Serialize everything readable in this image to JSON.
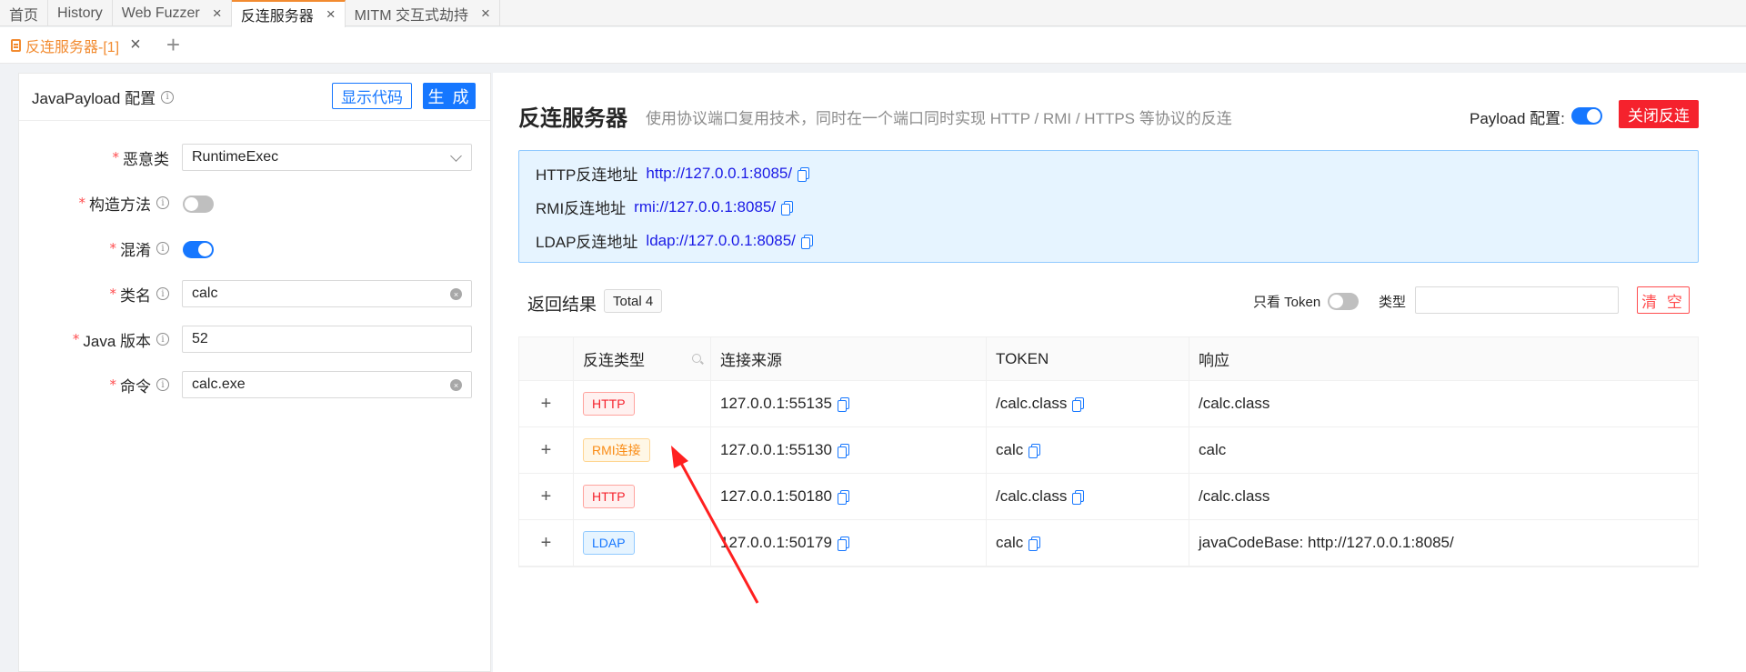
{
  "top_tabs": [
    {
      "label": "首页",
      "closable": false
    },
    {
      "label": "History",
      "closable": false
    },
    {
      "label": "Web Fuzzer",
      "closable": true
    },
    {
      "label": "反连服务器",
      "closable": true,
      "active": true
    },
    {
      "label": "MITM 交互式劫持",
      "closable": true
    }
  ],
  "sub_tabs": {
    "current": "反连服务器-[1]",
    "add_label": "+"
  },
  "left_panel": {
    "title": "JavaPayload 配置",
    "show_code_label": "显示代码",
    "generate_label": "生 成",
    "fields": {
      "malicious_class": {
        "label": "恶意类",
        "value": "RuntimeExec"
      },
      "constructor": {
        "label": "构造方法",
        "enabled": false
      },
      "obfuscate": {
        "label": "混淆",
        "enabled": true
      },
      "class_name": {
        "label": "类名",
        "value": "calc"
      },
      "java_version": {
        "label": "Java 版本",
        "value": "52"
      },
      "command": {
        "label": "命令",
        "value": "calc.exe"
      }
    }
  },
  "right_panel": {
    "title": "反连服务器",
    "subtitle": "使用协议端口复用技术，同时在一个端口同时实现 HTTP / RMI / HTTPS 等协议的反连",
    "payload_config_label": "Payload 配置:",
    "payload_config_enabled": true,
    "close_button": "关闭反连",
    "addresses": [
      {
        "label": "HTTP反连地址",
        "url": "http://127.0.0.1:8085/"
      },
      {
        "label": "RMI反连地址",
        "url": "rmi://127.0.0.1:8085/"
      },
      {
        "label": "LDAP反连地址",
        "url": "ldap://127.0.0.1:8085/"
      }
    ],
    "results_label": "返回结果",
    "total_label": "Total 4",
    "token_only_label": "只看 Token",
    "type_label": "类型",
    "type_placeholder": "",
    "clear_label": "清 空",
    "table": {
      "columns": [
        "",
        "反连类型",
        "连接来源",
        "TOKEN",
        "响应"
      ],
      "rows": [
        {
          "type": "HTTP",
          "type_color": "red",
          "source": "127.0.0.1:55135",
          "token": "/calc.class",
          "response": "/calc.class"
        },
        {
          "type": "RMI连接",
          "type_color": "orange",
          "source": "127.0.0.1:55130",
          "token": "calc",
          "response": "calc"
        },
        {
          "type": "HTTP",
          "type_color": "red",
          "source": "127.0.0.1:50180",
          "token": "/calc.class",
          "response": "/calc.class"
        },
        {
          "type": "LDAP",
          "type_color": "blue",
          "source": "127.0.0.1:50179",
          "token": "calc",
          "response": "javaCodeBase: http://127.0.0.1:8085/"
        }
      ]
    }
  },
  "colors": {
    "accent": "#1677ff",
    "danger": "#f5222d",
    "tab_active": "#f28b30",
    "annotation_arrow": "#ff2020"
  }
}
